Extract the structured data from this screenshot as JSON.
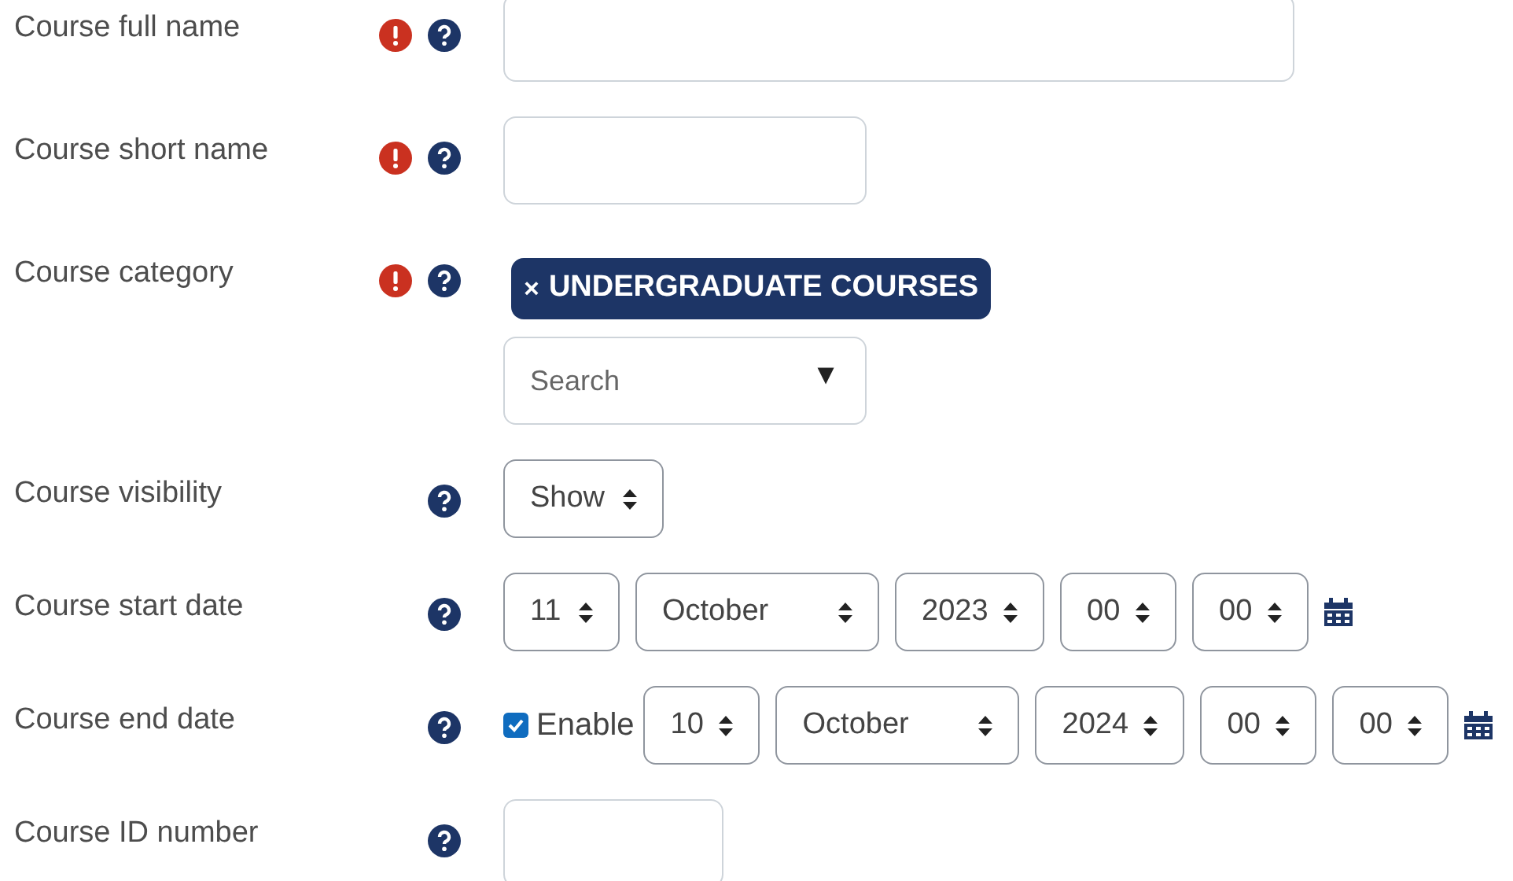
{
  "fields": [
    {
      "kind": "text",
      "label": "Course full name",
      "required": true
    },
    {
      "kind": "text",
      "label": "Course short name",
      "required": true
    },
    {
      "kind": "autocomplete",
      "label": "Course category",
      "required": true,
      "chip": {
        "remove": "×",
        "text": "UNDERGRADUATE COURSES"
      },
      "placeholder": "Search",
      "arrow": "▼"
    },
    {
      "kind": "select",
      "label": "Course visibility",
      "required": false,
      "value": "Show"
    },
    {
      "kind": "date",
      "label": "Course start date",
      "required": false,
      "parts": [
        "11",
        "October",
        "2023",
        "00",
        "00"
      ]
    },
    {
      "kind": "date",
      "label": "Course end date",
      "required": false,
      "enable": {
        "label": "Enable",
        "checked": true
      },
      "parts": [
        "10",
        "October",
        "2024",
        "00",
        "00"
      ]
    },
    {
      "kind": "text",
      "label": "Course ID number",
      "required": false
    }
  ]
}
